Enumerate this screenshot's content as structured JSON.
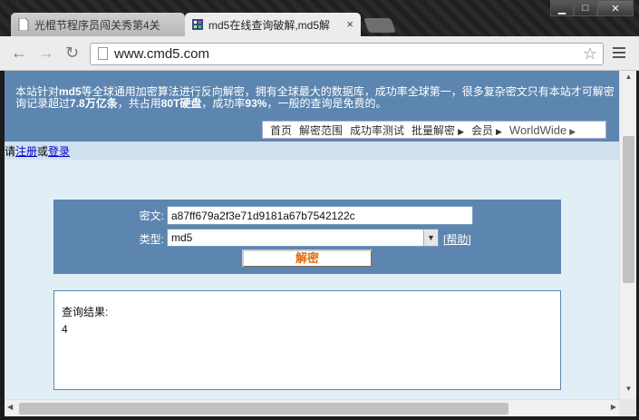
{
  "browser": {
    "tabs": [
      {
        "label": "光棍节程序员闯关秀第4关",
        "active": false,
        "icon": "page-icon"
      },
      {
        "label": "md5在线查询破解,md5解",
        "active": true,
        "icon": "cmd5-favicon"
      }
    ],
    "close_glyph": "×",
    "window_buttons": {
      "minimize": "▁",
      "maximize": "□",
      "close": "✕"
    },
    "url": "www.cmd5.com",
    "nav_icons": {
      "back": "←",
      "forward": "→",
      "reload": "↻",
      "star": "☆"
    }
  },
  "site": {
    "intro_pre": "本站针对",
    "intro_bold1": "md5",
    "intro_mid": "等全球通用加密算法进行反向解密，拥有全球最大的数据库，成功率全球第一，很多复杂密文只有本站才可解密",
    "intro_line2_pre": "询记录超过",
    "intro_bold2": "7.8万亿条",
    "intro_line2_mid": "，共占用",
    "intro_bold3": "80T硬盘",
    "intro_line2_mid2": "，成功率",
    "intro_bold4": "93%",
    "intro_line2_end": "，一般的查询是免费的。",
    "nav": [
      {
        "label": "首页",
        "has_arrow": false
      },
      {
        "label": "解密范围",
        "has_arrow": false
      },
      {
        "label": "成功率测试",
        "has_arrow": false
      },
      {
        "label": "批量解密",
        "has_arrow": true
      },
      {
        "label": "会员",
        "has_arrow": true
      },
      {
        "label": "WorldWide",
        "has_arrow": true
      }
    ],
    "arrow_glyph": "▶",
    "login_prefix": "请",
    "register_link": "注册",
    "login_or": "或",
    "login_link": "登录"
  },
  "form": {
    "cipher_label": "密文:",
    "cipher_value": "a87ff679a2f3e71d9181a67b7542122c",
    "type_label": "类型:",
    "type_value": "md5",
    "select_arrow": "▼",
    "help_link": "[帮助]",
    "decrypt_button": "解密"
  },
  "result": {
    "title": "查询结果:",
    "value": "4"
  },
  "scroll": {
    "up": "▲",
    "down": "▼",
    "left": "◀",
    "right": "▶"
  },
  "colors": {
    "banner": "#5c86b0",
    "page_bg": "#e2eef6",
    "button_text": "#e06a10",
    "link": "#0000cc"
  }
}
